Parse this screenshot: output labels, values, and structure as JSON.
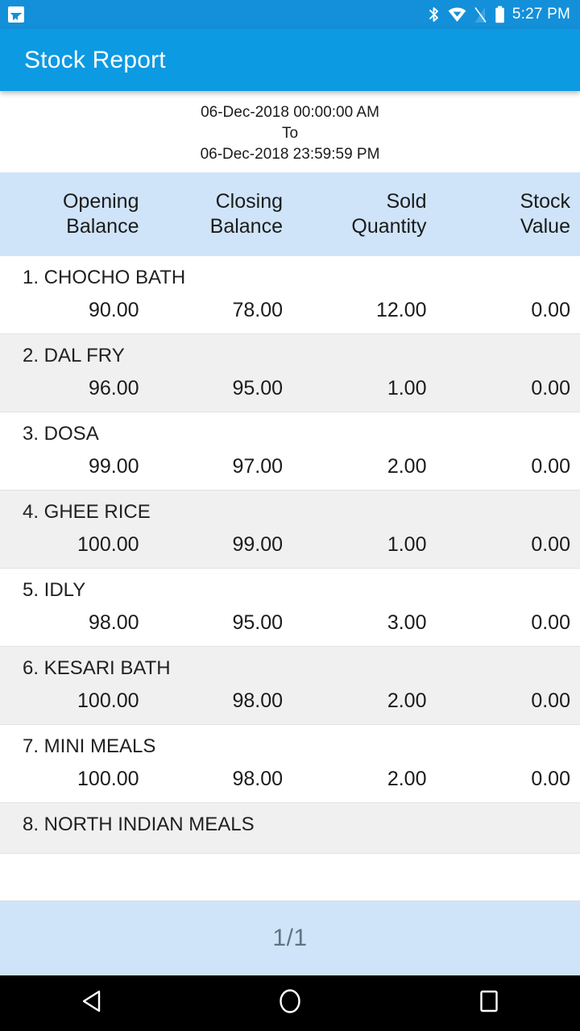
{
  "status_bar": {
    "left_icons": [
      "image-notification-icon"
    ],
    "right_icons": [
      "bluetooth-icon",
      "wifi-icon",
      "cellular-signal-off-icon",
      "battery-icon"
    ],
    "time": "5:27 PM",
    "background_color": "#1390d9"
  },
  "app_bar": {
    "title": "Stock Report",
    "background_color": "#0c9ae3",
    "text_color": "#ffffff"
  },
  "report": {
    "period": {
      "from": "06-Dec-2018 00:00:00 AM",
      "separator": "To",
      "to": "06-Dec-2018 23:59:59 PM"
    },
    "columns": [
      "Opening\nBalance",
      "Closing\nBalance",
      "Sold\nQuantity",
      "Stock\nValue"
    ],
    "column_headers": [
      {
        "line1": "Opening",
        "line2": "Balance"
      },
      {
        "line1": "Closing",
        "line2": "Balance"
      },
      {
        "line1": "Sold",
        "line2": "Quantity"
      },
      {
        "line1": "Stock",
        "line2": "Value"
      }
    ],
    "header_background_color": "#cfe4f9",
    "rows": [
      {
        "name": "1. CHOCHO BATH",
        "opening_balance": "90.00",
        "closing_balance": "78.00",
        "sold_quantity": "12.00",
        "stock_value": "0.00"
      },
      {
        "name": "2. DAL FRY",
        "opening_balance": "96.00",
        "closing_balance": "95.00",
        "sold_quantity": "1.00",
        "stock_value": "0.00"
      },
      {
        "name": "3. DOSA",
        "opening_balance": "99.00",
        "closing_balance": "97.00",
        "sold_quantity": "2.00",
        "stock_value": "0.00"
      },
      {
        "name": "4. GHEE RICE",
        "opening_balance": "100.00",
        "closing_balance": "99.00",
        "sold_quantity": "1.00",
        "stock_value": "0.00"
      },
      {
        "name": "5. IDLY",
        "opening_balance": "98.00",
        "closing_balance": "95.00",
        "sold_quantity": "3.00",
        "stock_value": "0.00"
      },
      {
        "name": "6. KESARI BATH",
        "opening_balance": "100.00",
        "closing_balance": "98.00",
        "sold_quantity": "2.00",
        "stock_value": "0.00"
      },
      {
        "name": "7. MINI MEALS",
        "opening_balance": "100.00",
        "closing_balance": "98.00",
        "sold_quantity": "2.00",
        "stock_value": "0.00"
      },
      {
        "name": "8. NORTH INDIAN MEALS",
        "opening_balance": "",
        "closing_balance": "",
        "sold_quantity": "",
        "stock_value": ""
      }
    ]
  },
  "pager": {
    "label": "1/1",
    "background_color": "#cfe4f9",
    "text_color": "#5f7482"
  },
  "nav_bar": {
    "buttons": [
      "back-button",
      "home-button",
      "recents-button"
    ],
    "background_color": "#000000"
  }
}
